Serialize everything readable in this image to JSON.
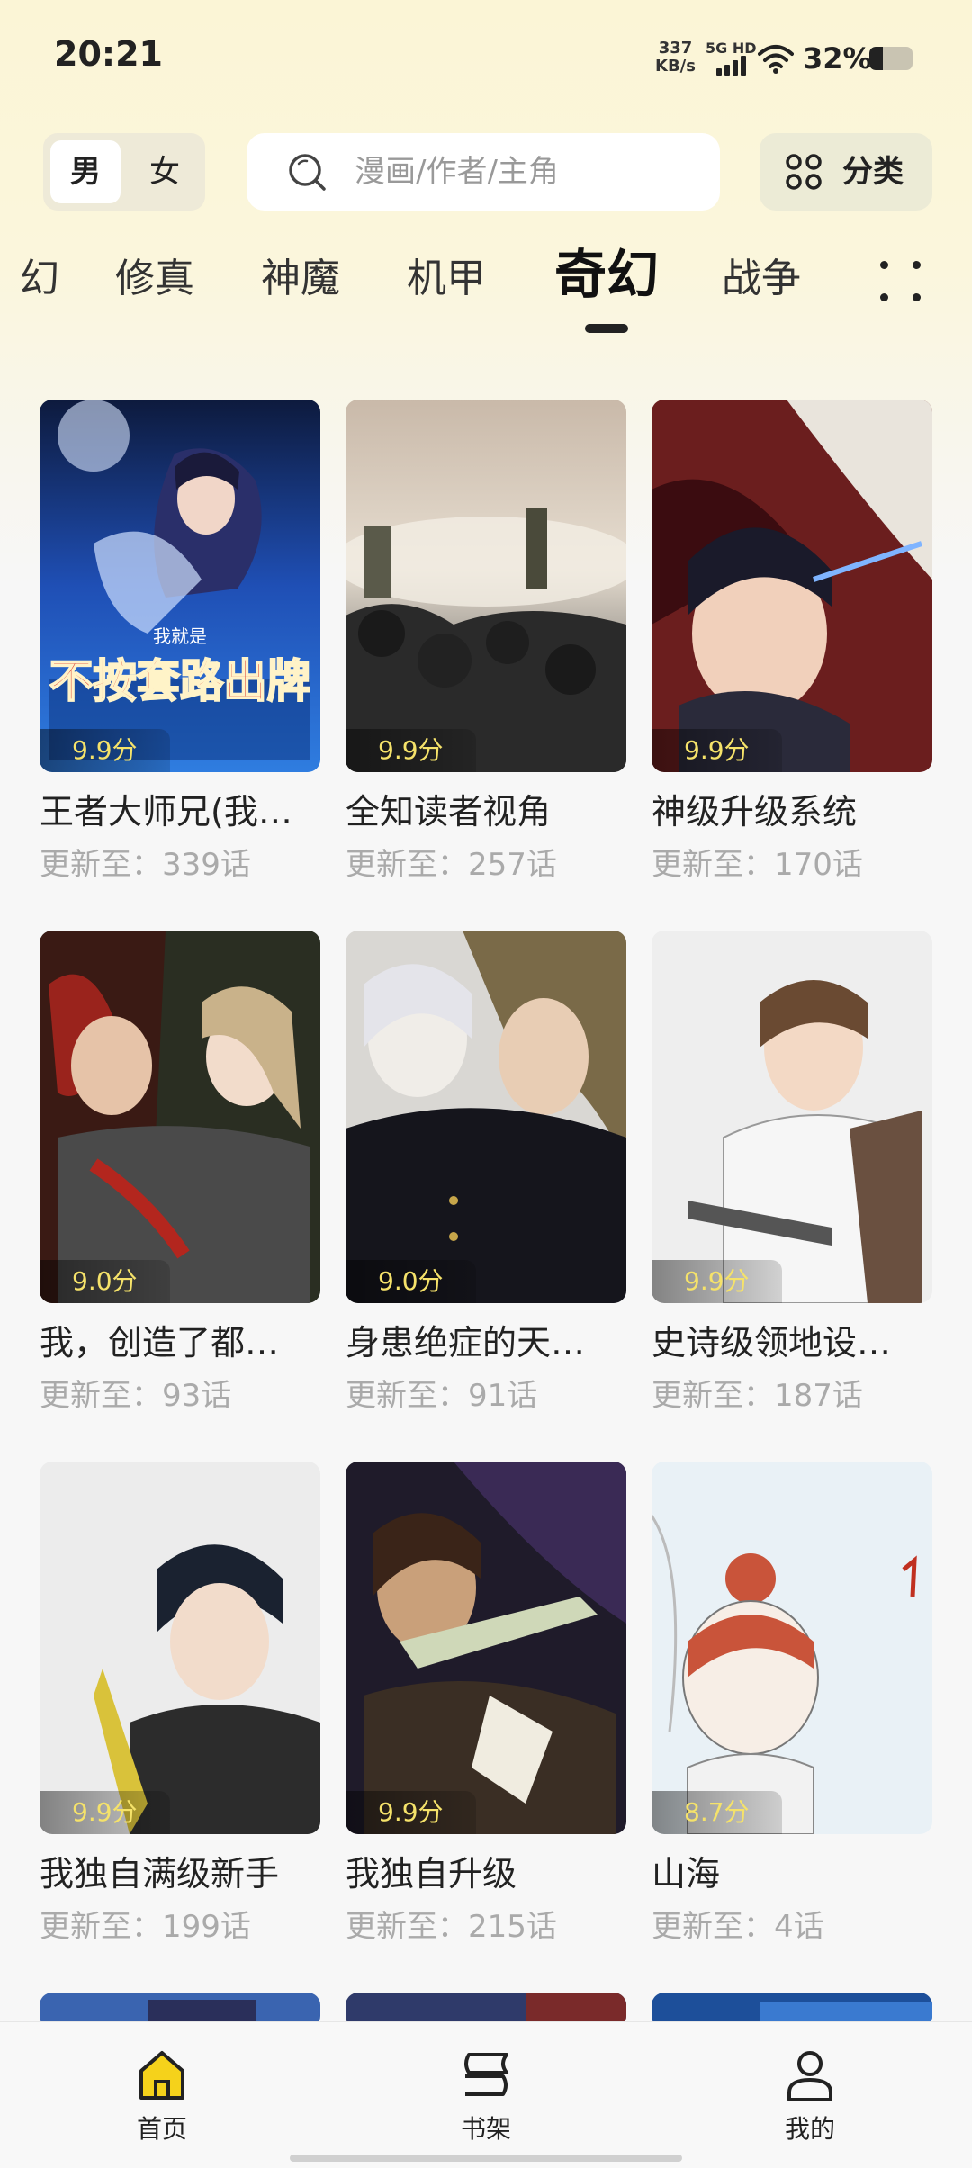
{
  "status_bar": {
    "time": "20:21",
    "net_speed_value": "337",
    "net_speed_unit": "KB/s",
    "network": "5G HD",
    "battery_pct": "32%",
    "battery_level": 0.32
  },
  "gender": {
    "male": "男",
    "female": "女",
    "selected": "男"
  },
  "search": {
    "placeholder": "漫画/作者/主角"
  },
  "category_button": {
    "label": "分类"
  },
  "genre_tabs": {
    "items": [
      "幻",
      "修真",
      "神魔",
      "机甲",
      "奇幻",
      "战争"
    ],
    "active": "奇幻"
  },
  "comics": [
    {
      "title": "王者大师兄(我…",
      "score": "9.9分",
      "update": "更新至：339话"
    },
    {
      "title": "全知读者视角",
      "score": "9.9分",
      "update": "更新至：257话"
    },
    {
      "title": "神级升级系统",
      "score": "9.9分",
      "update": "更新至：170话"
    },
    {
      "title": "我，创造了都…",
      "score": "9.0分",
      "update": "更新至：93话"
    },
    {
      "title": "身患绝症的天…",
      "score": "9.0分",
      "update": "更新至：91话"
    },
    {
      "title": "史诗级领地设…",
      "score": "9.9分",
      "update": "更新至：187话"
    },
    {
      "title": "我独自满级新手",
      "score": "9.9分",
      "update": "更新至：199话"
    },
    {
      "title": "我独自升级",
      "score": "9.9分",
      "update": "更新至：215话"
    },
    {
      "title": "山海",
      "score": "8.7分",
      "update": "更新至：4话"
    }
  ],
  "cover_art": {
    "0": {
      "title_art": "不按套路出牌",
      "small": "我就是"
    }
  },
  "bottom_nav": {
    "home": "首页",
    "bookshelf": "书架",
    "mine": "我的",
    "active": "首页"
  },
  "colors": {
    "accent_yellow": "#f5d21b",
    "score_text": "#f5e26a",
    "header_bg": "#fbf5d6"
  },
  "icons": [
    "search-icon",
    "grid-four-dots-icon",
    "more-dots-icon",
    "home-icon",
    "bookshelf-icon",
    "person-icon",
    "wifi-icon",
    "signal-icon",
    "battery-icon"
  ]
}
